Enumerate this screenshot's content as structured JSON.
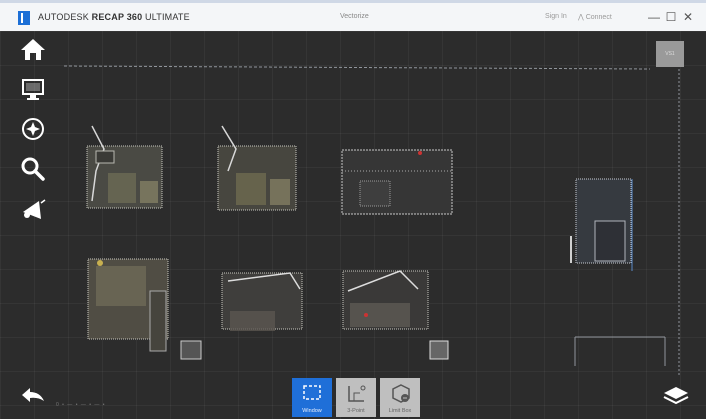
{
  "app": {
    "brand_prefix": "AUTODESK",
    "brand_product": "RECAP 360",
    "brand_suffix": "ULTIMATE",
    "document_title": "Vectorize",
    "sign_in": "Sign In",
    "connect": "Connect"
  },
  "window_controls": {
    "minimize": "—",
    "maximize": "☐",
    "close": "✕"
  },
  "sidebar": {
    "items": [
      {
        "icon": "home-icon"
      },
      {
        "icon": "display-icon"
      },
      {
        "icon": "navigate-icon"
      },
      {
        "icon": "search-icon"
      },
      {
        "icon": "announce-icon"
      }
    ]
  },
  "nav_badge": "VS1",
  "toolbar": {
    "tools": [
      {
        "label": "Window",
        "icon": "window-select-icon",
        "active": true
      },
      {
        "label": "3-Point",
        "icon": "three-point-icon",
        "active": false
      },
      {
        "label": "Limit Box",
        "icon": "limit-box-icon",
        "active": false
      }
    ]
  },
  "footer": {
    "scale_text": "0 • — • — • — •"
  },
  "colors": {
    "accent": "#1f6fd8",
    "background": "#2b2b2b",
    "titlebar": "#f4f6f8"
  }
}
